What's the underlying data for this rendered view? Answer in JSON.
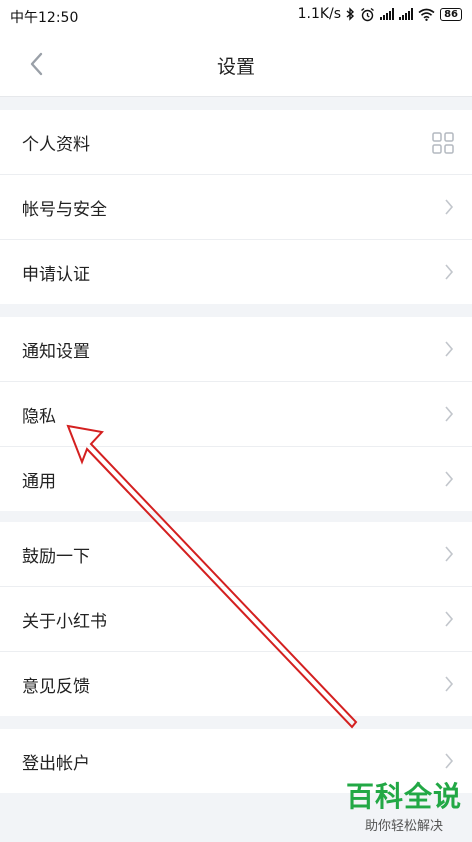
{
  "status_bar": {
    "time": "中午12:50",
    "network_speed": "1.1K/s",
    "battery": "86"
  },
  "nav": {
    "title": "设置"
  },
  "groups": [
    {
      "items": [
        {
          "label": "个人资料"
        },
        {
          "label": "帐号与安全"
        },
        {
          "label": "申请认证"
        }
      ]
    },
    {
      "items": [
        {
          "label": "通知设置"
        },
        {
          "label": "隐私"
        },
        {
          "label": "通用"
        }
      ]
    },
    {
      "items": [
        {
          "label": "鼓励一下"
        },
        {
          "label": "关于小红书"
        },
        {
          "label": "意见反馈"
        }
      ]
    },
    {
      "items": [
        {
          "label": "登出帐户"
        }
      ]
    }
  ],
  "annotation": {
    "color": "#d42020",
    "target": "隐私"
  },
  "watermark": {
    "title": "百科全说",
    "subtitle": "助你轻松解决"
  }
}
